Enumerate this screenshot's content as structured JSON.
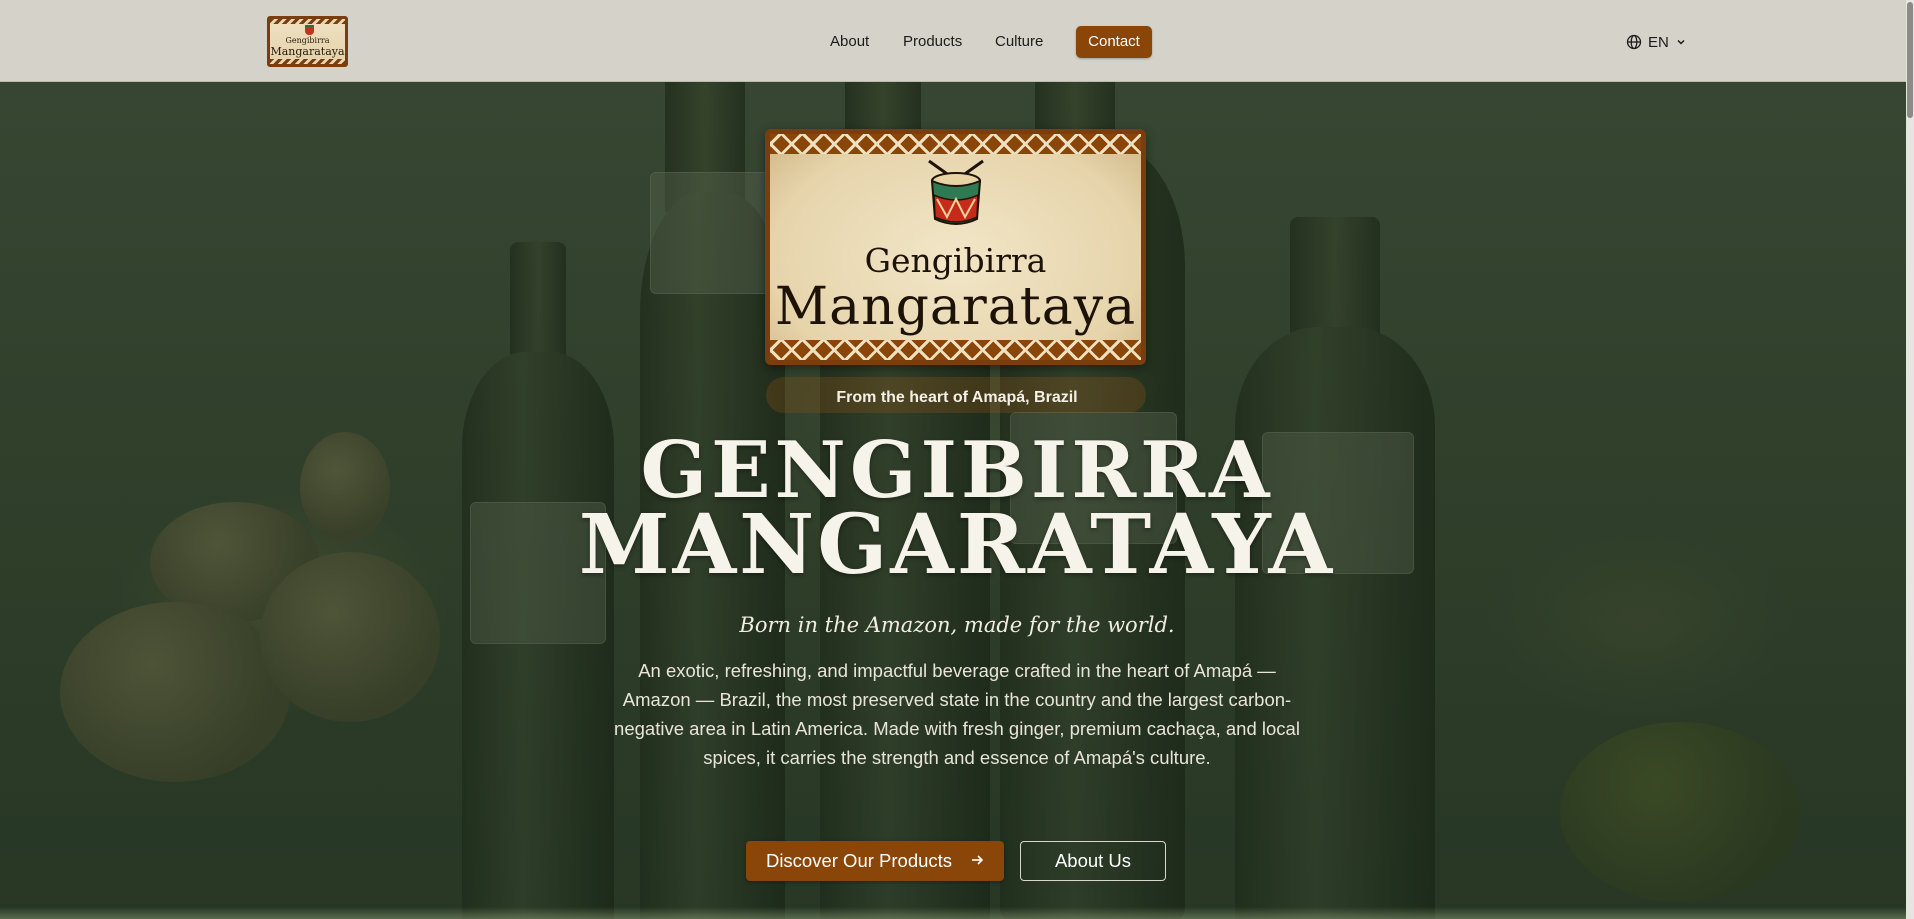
{
  "nav": {
    "logo": {
      "line1": "Gengibirra",
      "line2": "Mangarataya"
    },
    "links": [
      {
        "label": "About"
      },
      {
        "label": "Products"
      },
      {
        "label": "Culture"
      }
    ],
    "contact_label": "Contact",
    "language": {
      "icon": "globe-icon",
      "value": "EN",
      "caret_icon": "chevron-down-icon"
    }
  },
  "hero": {
    "logo": {
      "line1": "Gengibirra",
      "line2": "Mangarataya"
    },
    "eyebrow": "From the heart of Amapá, Brazil",
    "title_line1": "GENGIBIRRA",
    "title_line2": "MANGARATAYA",
    "subtitle": "Born in the Amazon, made for the world.",
    "description": "An exotic, refreshing, and impactful beverage crafted in the heart of Amapá — Amazon — Brazil, the most preserved state in the country and the largest carbon-negative area in Latin America. Made with fresh ginger, premium cachaça, and local spices, it carries the strength and essence of Amapá's culture.",
    "primary_button": {
      "label": "Discover Our Products",
      "icon": "arrow-right-icon"
    },
    "secondary_button": {
      "label": "About Us"
    }
  },
  "colors": {
    "accent": "#8a4508",
    "nav_bg": "#d4d2c9",
    "hero_overlay": "#3e4a38",
    "text_light": "#f6f3ea"
  }
}
